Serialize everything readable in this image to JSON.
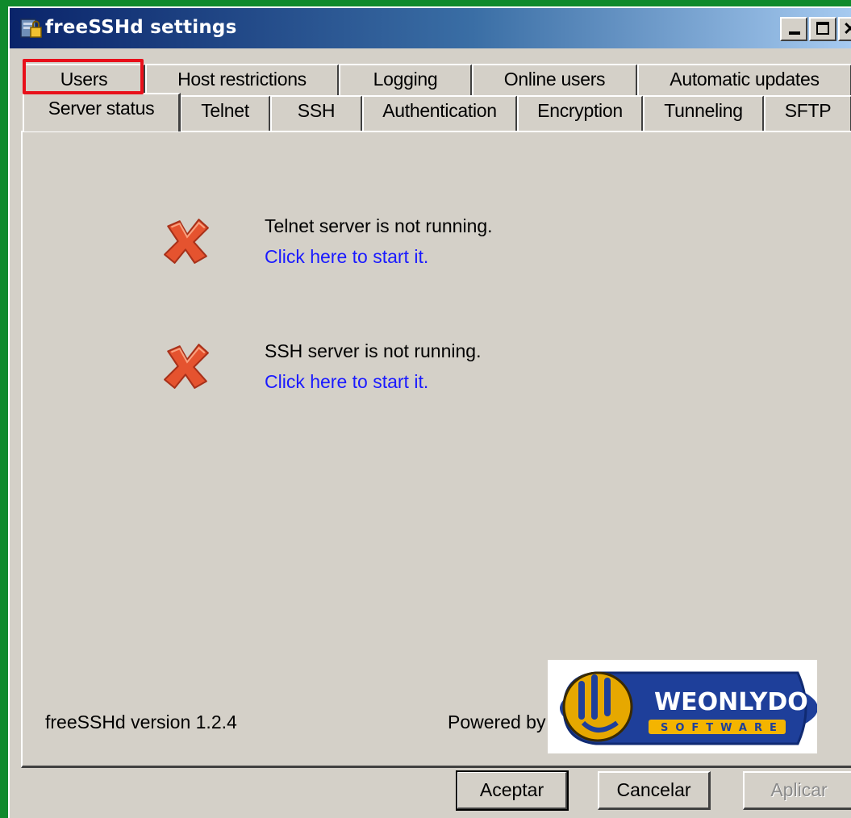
{
  "window": {
    "title": "freeSSHd settings",
    "controls": {
      "minimize": "_",
      "maximize": "□",
      "close": "✕"
    }
  },
  "tabs": {
    "row_back": [
      "Users",
      "Host restrictions",
      "Logging",
      "Online users",
      "Automatic updates"
    ],
    "row_front": [
      "Server status",
      "Telnet",
      "SSH",
      "Authentication",
      "Encryption",
      "Tunneling",
      "SFTP"
    ],
    "active": "Server status",
    "highlighted": "Users"
  },
  "status": {
    "telnet": {
      "message": "Telnet server is not running.",
      "link": "Click here to start it.",
      "icon": "red-x-icon"
    },
    "ssh": {
      "message": "SSH server is not running.",
      "link": "Click here to start it.",
      "icon": "red-x-icon"
    }
  },
  "footer": {
    "version": "freeSSHd version 1.2.4",
    "powered_by": "Powered by",
    "logo_text": "WEONLYDO",
    "logo_sub": "SOFTWARE"
  },
  "buttons": {
    "ok": "Aceptar",
    "cancel": "Cancelar",
    "apply": "Aplicar"
  },
  "colors": {
    "highlight": "#e8101a",
    "link": "#1a1aff",
    "background": "#d4d0c8",
    "titlebar": "#0a246a"
  }
}
